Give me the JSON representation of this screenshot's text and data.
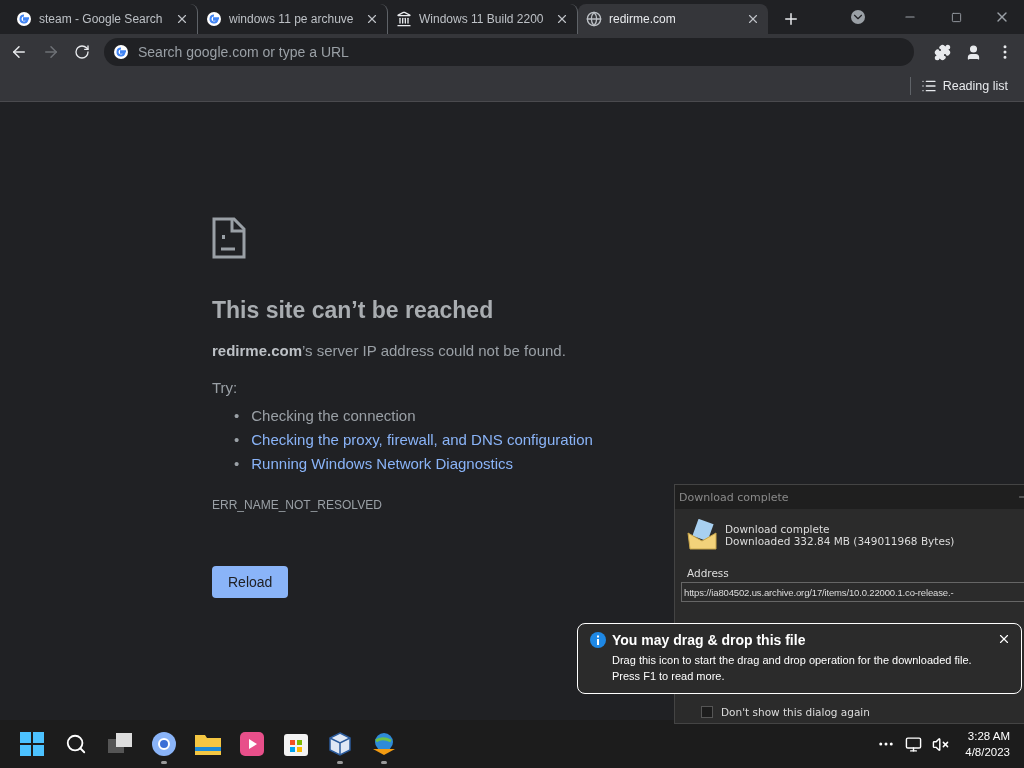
{
  "tabs": [
    {
      "title": "steam - Google Search",
      "kind": "google",
      "selected": false
    },
    {
      "title": "windows 11 pe archuve",
      "kind": "google",
      "selected": false
    },
    {
      "title": "Windows 11 Build 2200",
      "kind": "archive",
      "selected": false
    },
    {
      "title": "redirme.com",
      "kind": "globe",
      "selected": true
    }
  ],
  "toolbar": {
    "back_disabled": false,
    "forward_disabled": true,
    "omnibox": {
      "placeholder": "Search google.com or type a URL"
    }
  },
  "bookmarks_bar": {
    "reading_list": "Reading list"
  },
  "error_page": {
    "heading": "This site can’t be reached",
    "message": "**redirme.com**’s server IP address could not be found.",
    "try_label": "Try:",
    "suggestions": [
      {
        "bullet": "•",
        "text": "Checking the connection",
        "kind": "text"
      },
      {
        "bullet": "•",
        "text": "Checking the proxy, firewall, and DNS configuration",
        "kind": "link"
      },
      {
        "bullet": "•",
        "text": "Running Windows Network Diagnostics",
        "kind": "link"
      }
    ],
    "error_code": "ERR_NAME_NOT_RESOLVED",
    "reload_button": "Reload"
  },
  "download_dialog": {
    "title": "Download complete",
    "status": "Download complete",
    "size": "Downloaded 332.84  MB (349011968 Bytes)",
    "address_label": "Address",
    "address": "https://ia804502.us.archive.org/17/items/10.0.22000.1.co-release.-",
    "dont_show_again": {
      "label": "Don't show this dialog again",
      "checked": false
    }
  },
  "balloon": {
    "title": "You may drag & drop this file",
    "text": "Drag this icon to start the drag and drop operation for the downloaded file.\nPress F1 to read more."
  },
  "taskbar": {
    "apps": [
      {
        "kind": "start",
        "running": false
      },
      {
        "kind": "search",
        "running": false
      },
      {
        "kind": "taskview",
        "running": false
      },
      {
        "kind": "browser",
        "running": true
      },
      {
        "kind": "folder",
        "running": false
      },
      {
        "kind": "media",
        "running": false
      },
      {
        "kind": "store",
        "running": false
      },
      {
        "kind": "cube",
        "running": true
      },
      {
        "kind": "download",
        "running": true
      }
    ],
    "time": "3:28 AM",
    "date": "4/8/2023"
  }
}
